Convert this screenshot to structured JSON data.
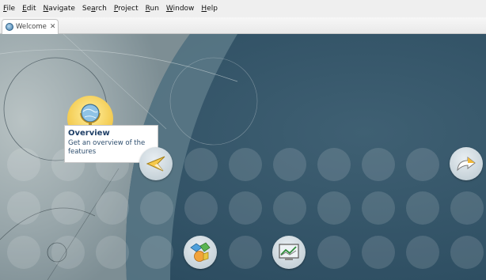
{
  "menu": [
    {
      "pre": "",
      "mn": "F",
      "post": "ile"
    },
    {
      "pre": "",
      "mn": "E",
      "post": "dit"
    },
    {
      "pre": "",
      "mn": "N",
      "post": "avigate"
    },
    {
      "pre": "Se",
      "mn": "a",
      "post": "rch"
    },
    {
      "pre": "",
      "mn": "P",
      "post": "roject"
    },
    {
      "pre": "",
      "mn": "R",
      "post": "un"
    },
    {
      "pre": "",
      "mn": "W",
      "post": "indow"
    },
    {
      "pre": "",
      "mn": "H",
      "post": "elp"
    }
  ],
  "tab": {
    "label": "Welcome",
    "close_symbol": "✕"
  },
  "toolbar": {
    "home_symbol": "⌂",
    "nav_symbol": "⇦"
  },
  "tooltip": {
    "title": "Overview",
    "description": "Get an overview of the features"
  },
  "icons": {
    "overview": "globe-icon",
    "tutorials": "compass-icon",
    "samples": "shapes-icon",
    "whats_new": "chart-screen-icon",
    "workbench": "arrow-curve-icon"
  },
  "colors": {
    "content_bg": "#2f5064",
    "active_button": "#f2c84a",
    "tooltip_title": "#1f3f66"
  }
}
